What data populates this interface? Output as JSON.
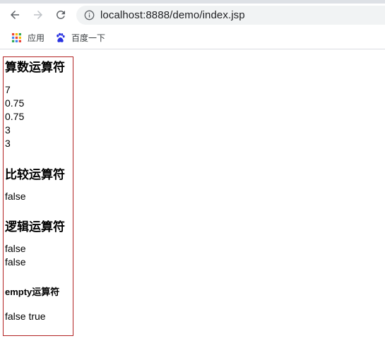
{
  "browser": {
    "url": "localhost:8888/demo/index.jsp",
    "bookmarks": [
      {
        "label": "应用",
        "icon": "apps-grid-icon"
      },
      {
        "label": "百度一下",
        "icon": "baidu-paw-icon"
      }
    ]
  },
  "page": {
    "sections": [
      {
        "heading": "算数运算符",
        "lines": [
          "7",
          "0.75",
          "0.75",
          "3",
          "3"
        ]
      },
      {
        "heading": "比较运算符",
        "lines": [
          "false"
        ]
      },
      {
        "heading": "逻辑运算符",
        "lines": [
          "false",
          "false"
        ]
      },
      {
        "heading": "empty运算符",
        "lines": [
          "false true"
        ]
      }
    ]
  },
  "colors": {
    "outline": "#b22222",
    "omnibox_bg": "#f1f3f4",
    "tab_strip": "#dee1e6"
  }
}
